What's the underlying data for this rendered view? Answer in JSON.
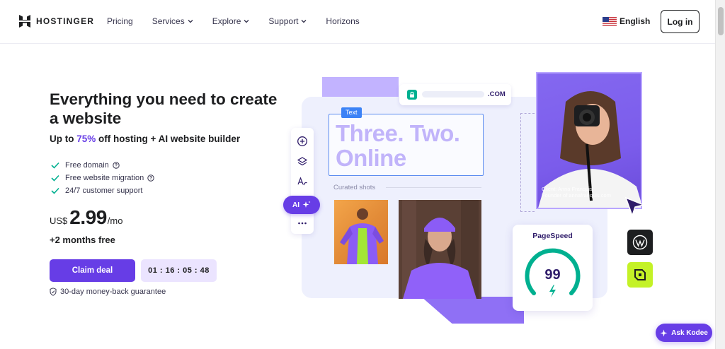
{
  "header": {
    "logo_text": "HOSTINGER",
    "nav": [
      {
        "label": "Pricing",
        "dropdown": false
      },
      {
        "label": "Services",
        "dropdown": true
      },
      {
        "label": "Explore",
        "dropdown": true
      },
      {
        "label": "Support",
        "dropdown": true
      },
      {
        "label": "Horizons",
        "dropdown": false
      }
    ],
    "language": "English",
    "login": "Log in"
  },
  "hero": {
    "title": "Everything you need to create a website",
    "subtitle_prefix": "Up to ",
    "subtitle_pct": "75%",
    "subtitle_suffix": " off hosting + AI website builder",
    "features": [
      "Free domain",
      "Free website migration",
      "24/7 customer support"
    ],
    "price_currency": "US$",
    "price_amount": "2.99",
    "price_period": "/mo",
    "free_months": "+2 months free",
    "cta": "Claim deal",
    "timer": "01 : 16 : 05 : 48",
    "guarantee": "30-day money-back guarantee"
  },
  "illustration": {
    "url_tld": ".COM",
    "text_tag": "Text",
    "headline_line1": "Three. Two.",
    "headline_line2": "Online",
    "curated": "Curated shots",
    "ai_label": "AI",
    "client_line1": "Client: Anna Franquis",
    "client_line2": "Founder of annafranquis.com",
    "pagespeed_title": "PageSpeed",
    "pagespeed_score": "99"
  },
  "assistant": {
    "label": "Ask Kodee"
  },
  "colors": {
    "brand": "#673de6",
    "accent_green": "#00b090",
    "lime": "#c4f227",
    "dark": "#1d1e20"
  },
  "icons": [
    "hostinger-logo-icon",
    "chevron-down-icon",
    "us-flag-icon",
    "check-icon",
    "question-icon",
    "shield-icon",
    "lock-icon",
    "plus-circle-icon",
    "layers-icon",
    "text-style-icon",
    "sparkle-icon",
    "more-icon",
    "cursor-icon",
    "wordpress-icon",
    "lime-brand-icon",
    "lightning-icon"
  ]
}
